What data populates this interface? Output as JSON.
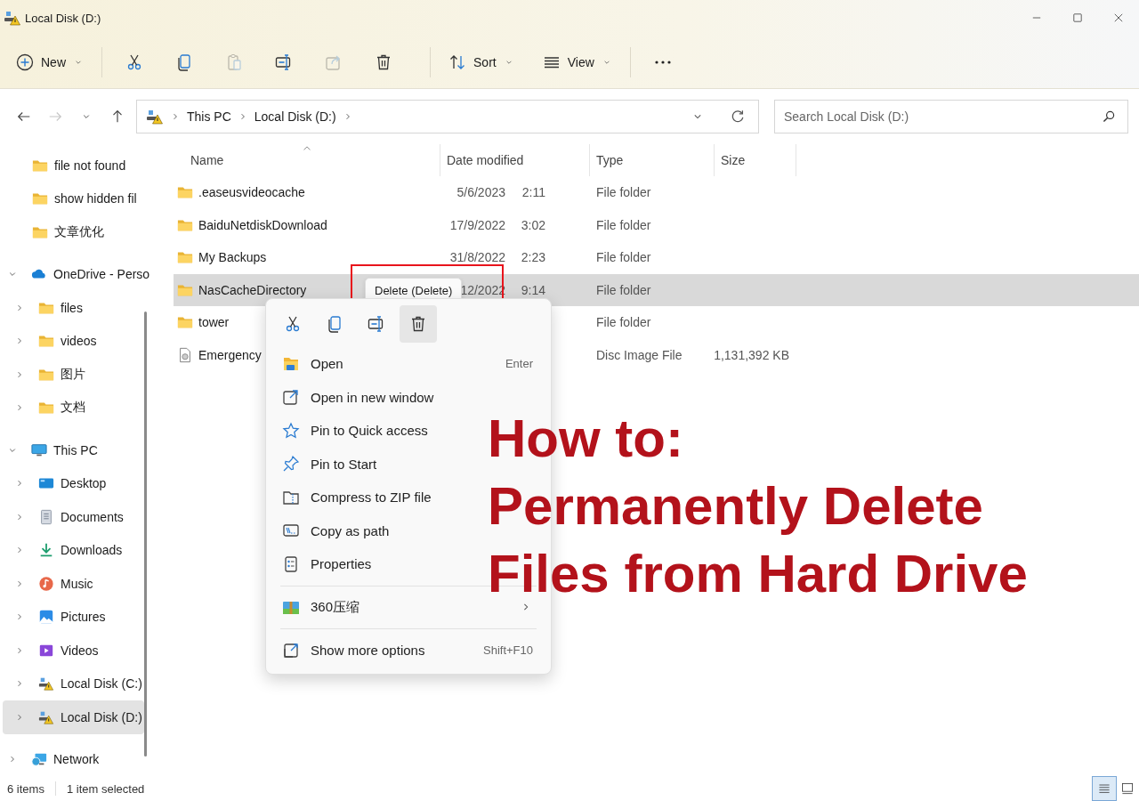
{
  "window": {
    "title": "Local Disk (D:)"
  },
  "toolbar": {
    "new": {
      "label": "New"
    },
    "actions": [
      {
        "kind": "cut",
        "disabled": false
      },
      {
        "kind": "copy",
        "disabled": false
      },
      {
        "kind": "paste",
        "disabled": true
      },
      {
        "kind": "rename",
        "disabled": false
      },
      {
        "kind": "share",
        "disabled": true
      },
      {
        "kind": "delete",
        "disabled": false
      }
    ],
    "sort": {
      "label": "Sort"
    },
    "view": {
      "label": "View"
    }
  },
  "navigation": [
    {
      "kind": "back",
      "disabled": false
    },
    {
      "kind": "forward",
      "disabled": true
    },
    {
      "kind": "recent",
      "disabled": false
    },
    {
      "kind": "up",
      "disabled": false
    }
  ],
  "address": {
    "crumbs": [
      "This PC",
      "Local Disk (D:)"
    ]
  },
  "search": {
    "placeholder": "Search Local Disk (D:)"
  },
  "sidebar": {
    "pinned": [
      {
        "label": "file not found",
        "kind": "folder",
        "selected": false
      },
      {
        "label": "show hidden fil",
        "kind": "folder",
        "selected": false
      },
      {
        "label": "文章优化",
        "kind": "folder",
        "selected": false
      }
    ],
    "tree": [
      {
        "label": "OneDrive - Perso",
        "kind": "cloud",
        "expanded": true,
        "selected": false,
        "children": [
          {
            "label": "files",
            "kind": "folder",
            "expanded": false,
            "selected": false
          },
          {
            "label": "videos",
            "kind": "folder",
            "expanded": false,
            "selected": false
          },
          {
            "label": "图片",
            "kind": "folder",
            "expanded": false,
            "selected": false
          },
          {
            "label": "文档",
            "kind": "folder",
            "expanded": false,
            "selected": false
          }
        ]
      },
      {
        "label": "This PC",
        "kind": "pc",
        "expanded": true,
        "selected": false,
        "children": [
          {
            "label": "Desktop",
            "kind": "desktop",
            "expanded": false,
            "selected": false
          },
          {
            "label": "Documents",
            "kind": "documents",
            "expanded": false,
            "selected": false
          },
          {
            "label": "Downloads",
            "kind": "downloads",
            "expanded": false,
            "selected": false
          },
          {
            "label": "Music",
            "kind": "music",
            "expanded": false,
            "selected": false
          },
          {
            "label": "Pictures",
            "kind": "pictures",
            "expanded": false,
            "selected": false
          },
          {
            "label": "Videos",
            "kind": "videos",
            "expanded": false,
            "selected": false
          },
          {
            "label": "Local Disk (C:)",
            "kind": "drive",
            "expanded": false,
            "selected": false
          },
          {
            "label": "Local Disk (D:)",
            "kind": "drive",
            "expanded": false,
            "selected": true
          }
        ]
      },
      {
        "label": "Network",
        "kind": "network",
        "expanded": false,
        "selected": false
      }
    ]
  },
  "columns": [
    {
      "label": "Name",
      "sorted": true
    },
    {
      "label": "Date modified",
      "sorted": false
    },
    {
      "label": "Type",
      "sorted": false
    },
    {
      "label": "Size",
      "sorted": false
    }
  ],
  "rows": [
    {
      "kind": "folder",
      "name": ".easeusvideocache",
      "date": "5/6/2023",
      "time": "2:11",
      "type": "File folder",
      "selected": false
    },
    {
      "kind": "folder",
      "name": "BaiduNetdiskDownload",
      "date": "17/9/2022",
      "time": "3:02",
      "type": "File folder",
      "selected": false
    },
    {
      "kind": "folder",
      "name": "My Backups",
      "date": "31/8/2022",
      "time": "2:23",
      "type": "File folder",
      "selected": false
    },
    {
      "kind": "folder",
      "name": "NasCacheDirectory",
      "date": "12/2022",
      "time": "9:14",
      "type": "File folder",
      "selected": true
    },
    {
      "kind": "folder",
      "name": "tower",
      "type": "File folder",
      "selected": false
    },
    {
      "kind": "disc",
      "name": "Emergency",
      "type": "Disc Image File",
      "size": "1,131,392 KB",
      "selected": false
    }
  ],
  "context_menu": {
    "quick_actions": [
      {
        "kind": "cut",
        "highlighted": false
      },
      {
        "kind": "copy",
        "highlighted": false
      },
      {
        "kind": "rename",
        "highlighted": false
      },
      {
        "kind": "delete",
        "highlighted": true
      }
    ],
    "groups": [
      [
        {
          "kind": "open",
          "label": "Open",
          "shortcut": "Enter"
        },
        {
          "kind": "newwindow",
          "label": "Open in new window"
        },
        {
          "kind": "star",
          "label": "Pin to Quick access"
        },
        {
          "kind": "pin",
          "label": "Pin to Start"
        },
        {
          "kind": "zip",
          "label": "Compress to ZIP file"
        },
        {
          "kind": "path",
          "label": "Copy as path"
        },
        {
          "kind": "properties",
          "label": "Properties"
        }
      ],
      [
        {
          "kind": "archive",
          "label": "360压缩",
          "submenu": true
        }
      ],
      [
        {
          "kind": "moreoptions",
          "label": "Show more options",
          "shortcut": "Shift+F10"
        }
      ]
    ]
  },
  "tooltip": "Delete (Delete)",
  "highlight_box": true,
  "headline": [
    "How to:",
    "Permanently Delete",
    "Files from Hard Drive"
  ],
  "status_bar": {
    "item_count": "6 items",
    "selection": "1 item selected",
    "views": [
      {
        "kind": "details",
        "selected": true
      },
      {
        "kind": "tiles",
        "selected": false
      }
    ]
  }
}
